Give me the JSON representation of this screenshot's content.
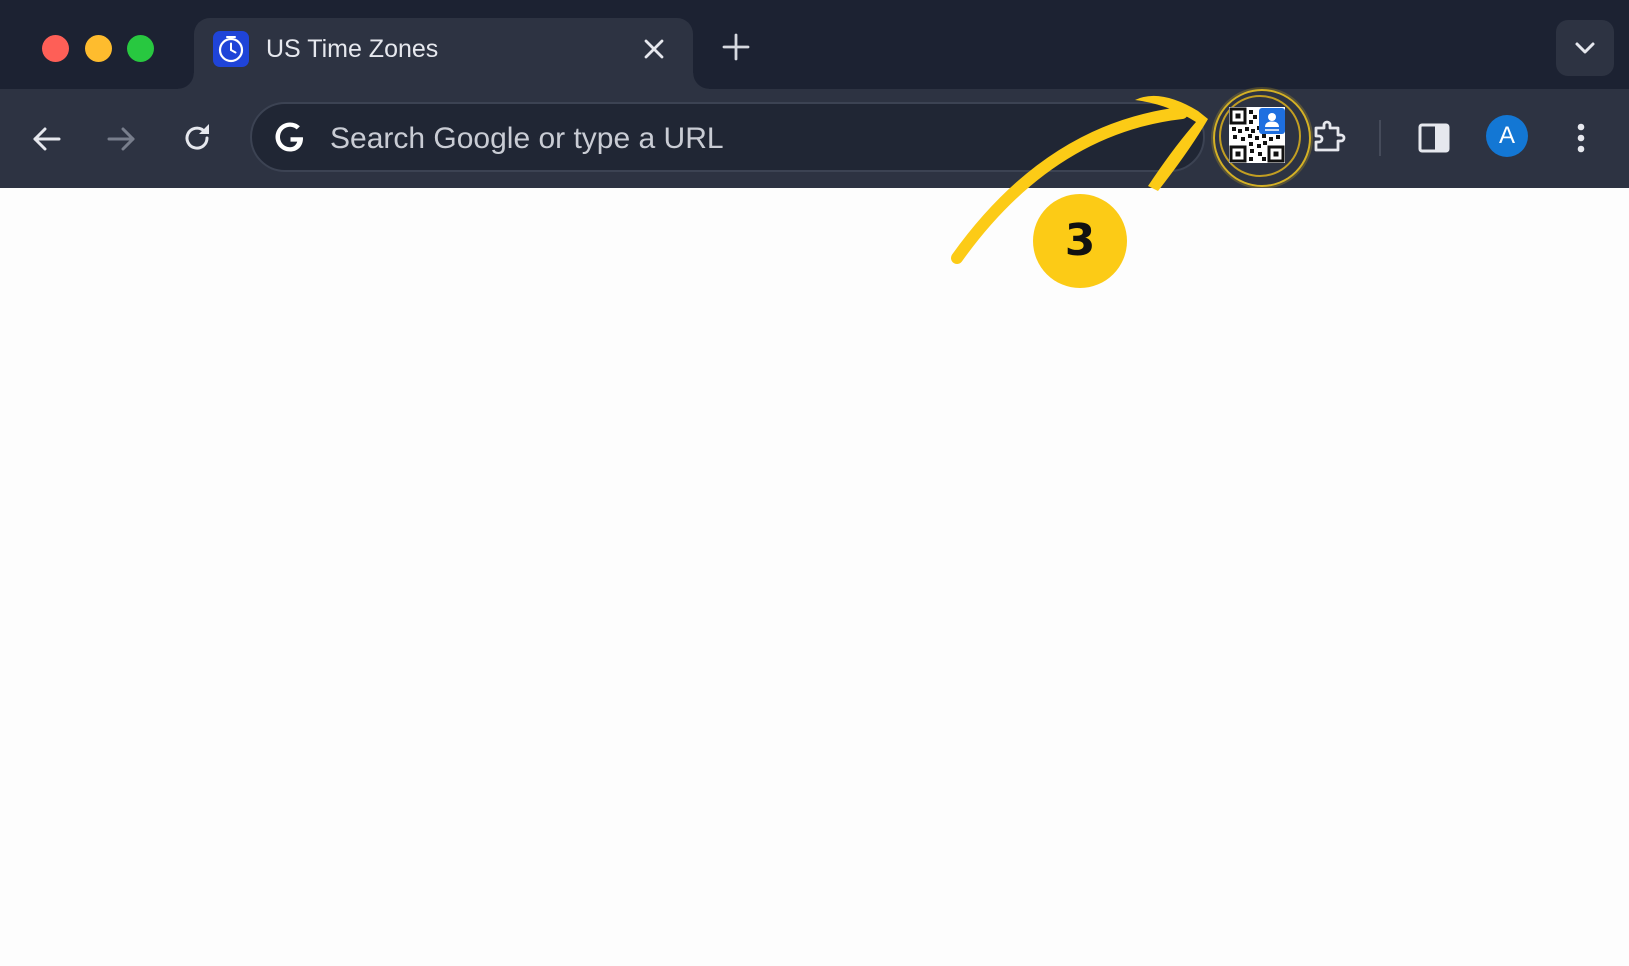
{
  "window": {
    "traffic_lights": {
      "close_color": "#fe5f57",
      "minimize_color": "#febc2e",
      "maximize_color": "#28c840"
    }
  },
  "tab": {
    "title": "US Time Zones",
    "favicon": "clock-icon",
    "close_icon": "close-icon",
    "new_tab_icon": "plus-icon",
    "tab_search_icon": "chevron-down-icon"
  },
  "toolbar": {
    "back_icon": "arrow-left-icon",
    "forward_icon": "arrow-right-icon",
    "reload_icon": "reload-icon",
    "omnibox": {
      "icon": "google-g-icon",
      "placeholder": "Search Google or type a URL",
      "value": ""
    },
    "extension_icon": "qr-code-icon",
    "extensions_icon": "puzzle-icon",
    "side_panel_icon": "side-panel-icon",
    "avatar_letter": "A",
    "menu_icon": "kebab-menu-icon"
  },
  "annotation": {
    "step_number": "3",
    "color": "#fccb16"
  },
  "theme": {
    "tabstrip_bg": "#1c2232",
    "toolbar_bg": "#2d3342",
    "avatar_bg": "#1377d4"
  }
}
